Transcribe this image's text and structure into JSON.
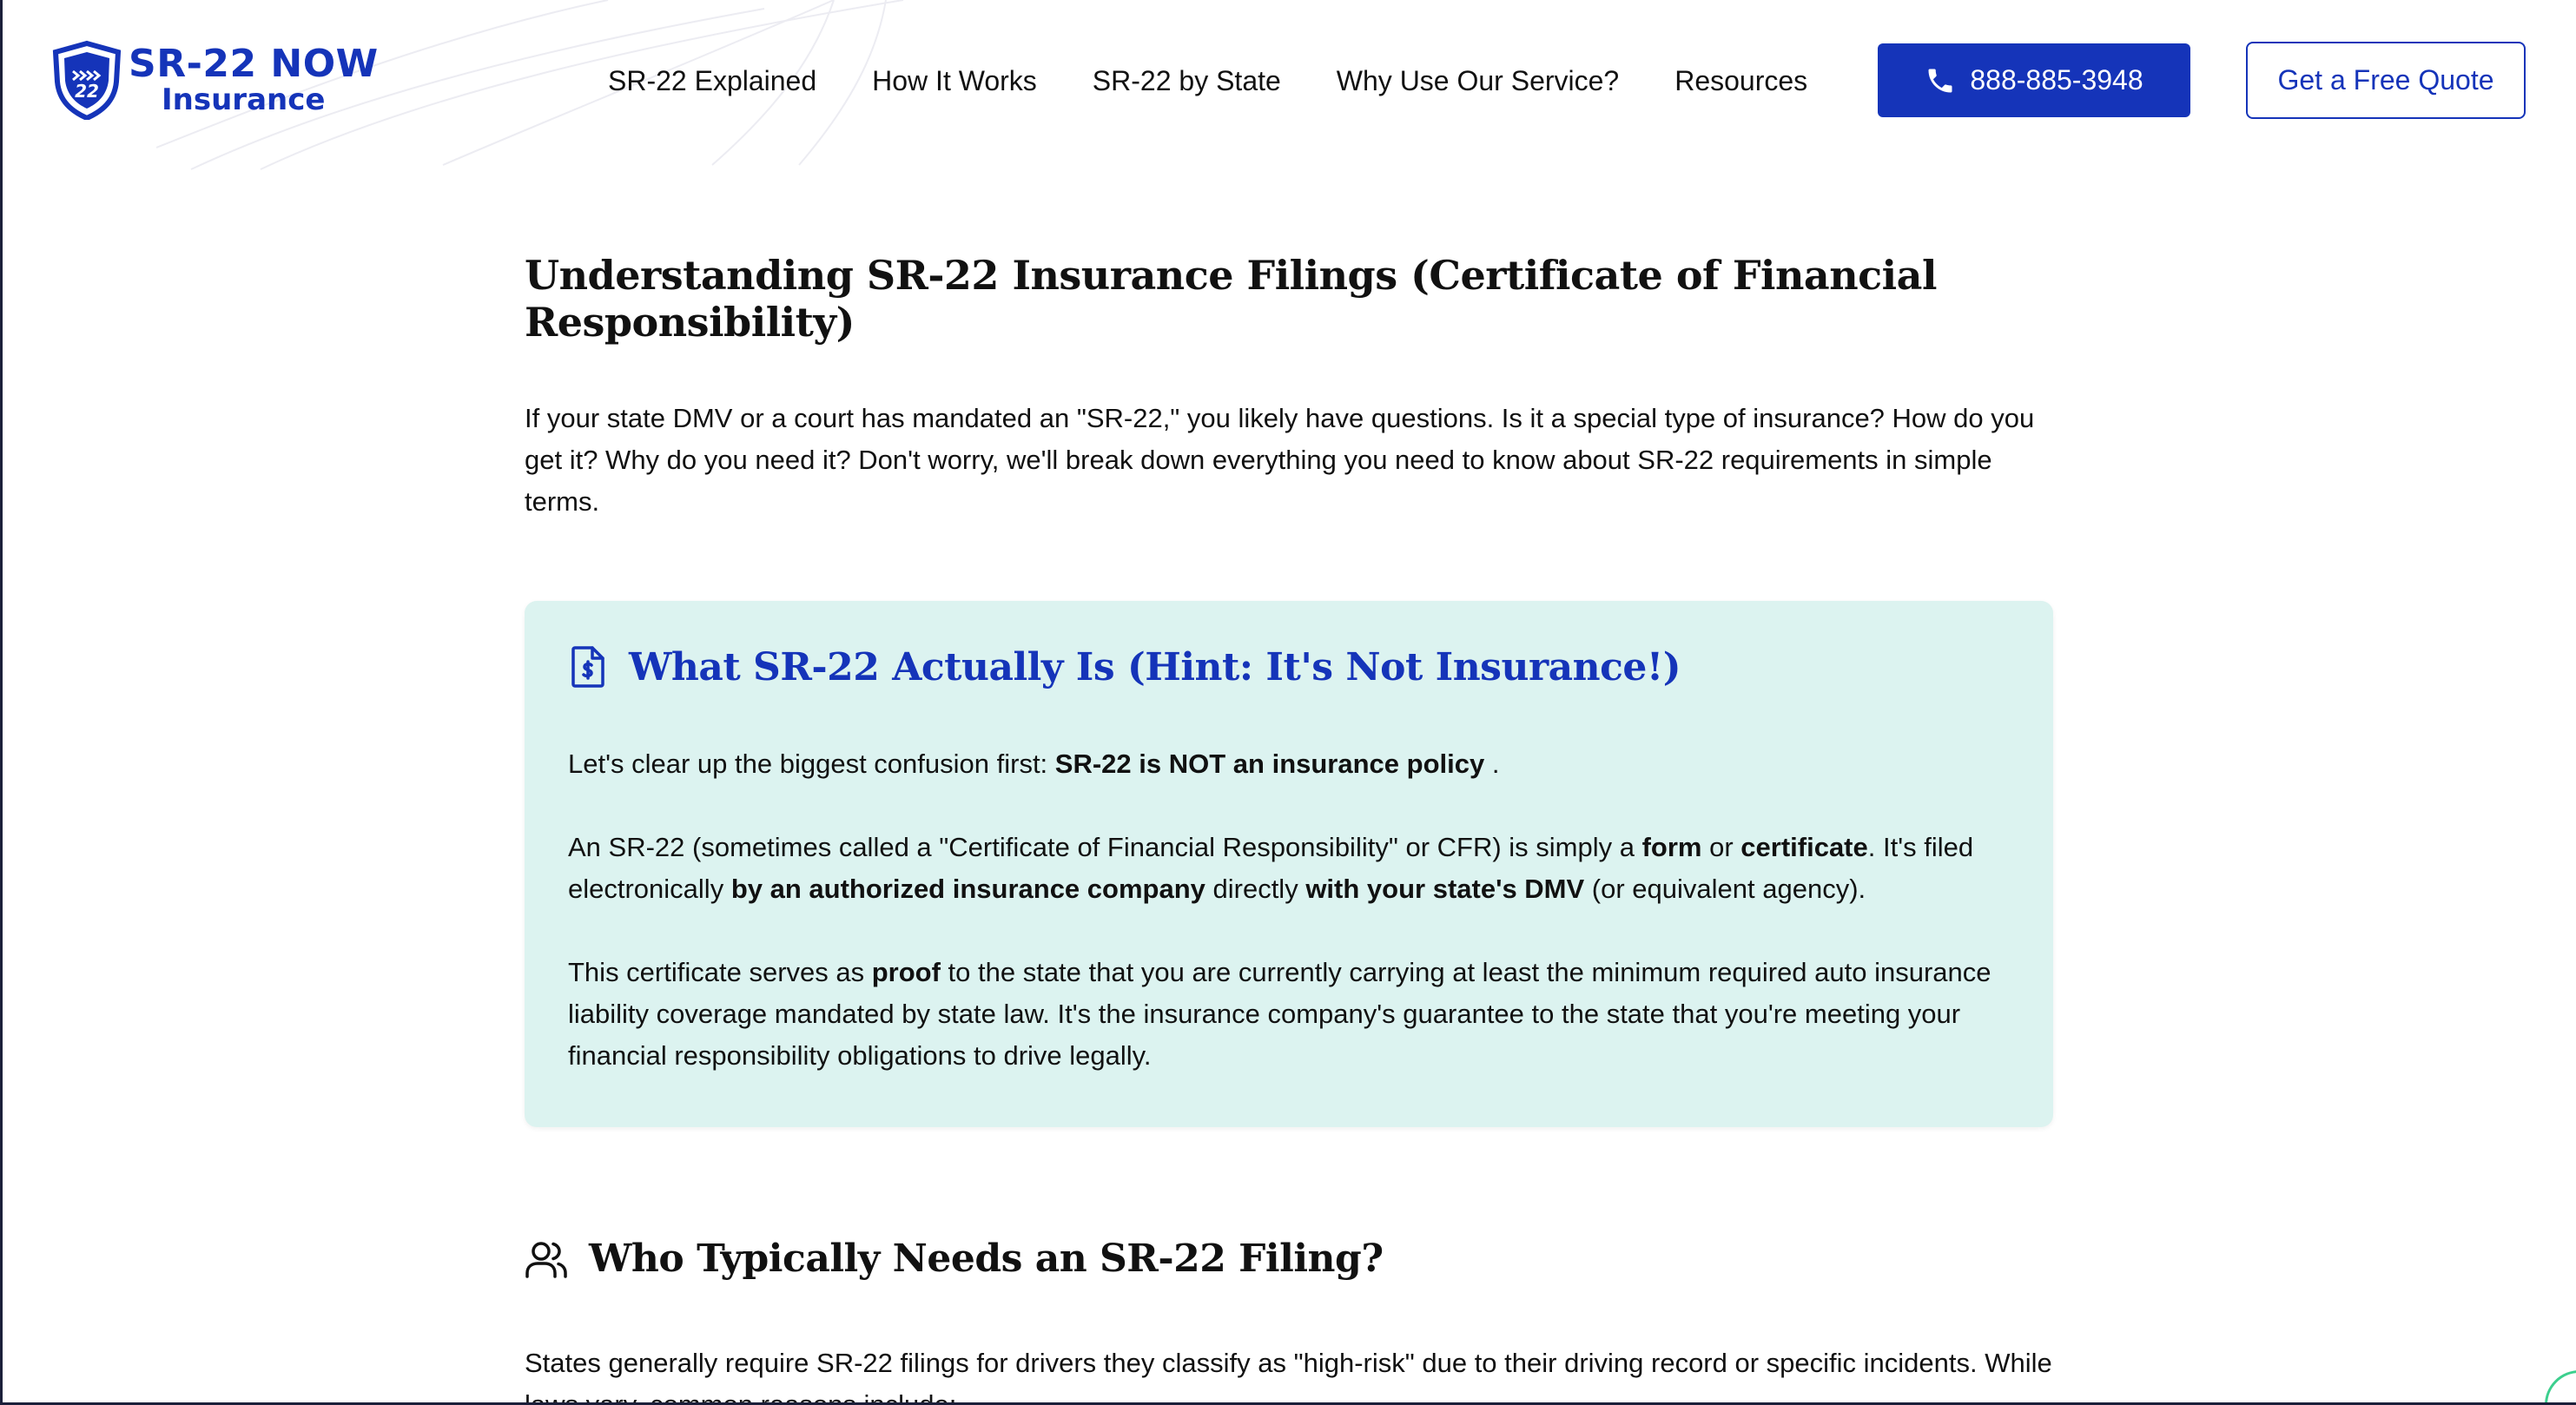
{
  "header": {
    "logo": {
      "main": "SR-22 NOW",
      "sub": "Insurance",
      "badge": "22"
    },
    "nav": [
      {
        "label": "SR-22 Explained"
      },
      {
        "label": "How It Works"
      },
      {
        "label": "SR-22 by State"
      },
      {
        "label": "Why Use Our Service?"
      },
      {
        "label": "Resources"
      }
    ],
    "phone": {
      "label": "888-885-3948",
      "icon": "phone-icon"
    },
    "quote": {
      "label": "Get a Free Quote"
    }
  },
  "main": {
    "title": "Understanding SR-22 Insurance Filings (Certificate of Financial Responsibility)",
    "intro": "If your state DMV or a court has mandated an \"SR-22,\" you likely have questions. Is it a special type of insurance? How do you get it? Why do you need it? Don't worry, we'll break down everything you need to know about SR-22 requirements in simple terms."
  },
  "card": {
    "icon": "document-dollar-icon",
    "title": "What SR-22 Actually Is (Hint: It's Not Insurance!)",
    "p1": {
      "a": "Let's clear up the biggest confusion first: ",
      "b": "SR-22 is NOT an insurance policy",
      "c": " ."
    },
    "p2": {
      "a": "An SR-22 (sometimes called a \"Certificate of Financial Responsibility\" or CFR) is simply a ",
      "b": "form",
      "c": " or ",
      "d": "certificate",
      "e": ". It's filed electronically ",
      "f": "by an authorized insurance company",
      "g": " directly ",
      "h": "with your state's DMV",
      "i": " (or equivalent agency)."
    },
    "p3": {
      "a": "This certificate serves as ",
      "b": "proof",
      "c": " to the state that you are currently carrying at least the minimum required auto insurance liability coverage mandated by state law. It's the insurance company's guarantee to the state that you're meeting your financial responsibility obligations to drive legally."
    }
  },
  "who": {
    "icon": "users-icon",
    "title": "Who Typically Needs an SR-22 Filing?",
    "text": "States generally require SR-22 filings for drivers they classify as \"high-risk\" due to their driving record or specific incidents. While laws vary, common reasons include:"
  },
  "colors": {
    "brand": "#1534b9",
    "card_bg": "#dcf3f0"
  }
}
